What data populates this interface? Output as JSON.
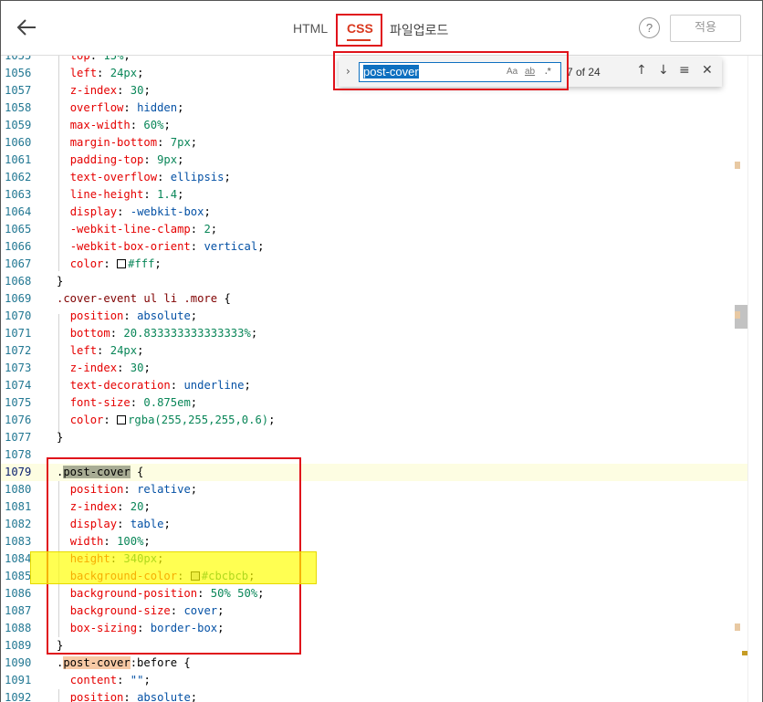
{
  "topbar": {
    "tabs": [
      {
        "label": "HTML"
      },
      {
        "label": "CSS"
      },
      {
        "label": "파일업로드"
      }
    ],
    "help_label": "?",
    "apply_label": "적용"
  },
  "find": {
    "value": "post-cover",
    "match_case": "Aa",
    "whole_word": "ab",
    "regex": ".*",
    "count": "7 of 24"
  },
  "lines": [
    {
      "n": "1055",
      "t": "  top: 15%;"
    },
    {
      "n": "1056",
      "t": "  left: 24px;"
    },
    {
      "n": "1057",
      "t": "  z-index: 30;"
    },
    {
      "n": "1058",
      "t": "  overflow: hidden;"
    },
    {
      "n": "1059",
      "t": "  max-width: 60%;"
    },
    {
      "n": "1060",
      "t": "  margin-bottom: 7px;"
    },
    {
      "n": "1061",
      "t": "  padding-top: 9px;"
    },
    {
      "n": "1062",
      "t": "  text-overflow: ellipsis;"
    },
    {
      "n": "1063",
      "t": "  line-height: 1.4;"
    },
    {
      "n": "1064",
      "t": "  display: -webkit-box;"
    },
    {
      "n": "1065",
      "t": "  -webkit-line-clamp: 2;"
    },
    {
      "n": "1066",
      "t": "  -webkit-box-orient: vertical;"
    },
    {
      "n": "1067",
      "t": "  color: #fff;"
    },
    {
      "n": "1068",
      "t": "}"
    },
    {
      "n": "1069",
      "t": ".cover-event ul li .more {"
    },
    {
      "n": "1070",
      "t": "  position: absolute;"
    },
    {
      "n": "1071",
      "t": "  bottom: 20.833333333333333%;"
    },
    {
      "n": "1072",
      "t": "  left: 24px;"
    },
    {
      "n": "1073",
      "t": "  z-index: 30;"
    },
    {
      "n": "1074",
      "t": "  text-decoration: underline;"
    },
    {
      "n": "1075",
      "t": "  font-size: 0.875em;"
    },
    {
      "n": "1076",
      "t": "  color: rgba(255,255,255,0.6);"
    },
    {
      "n": "1077",
      "t": "}"
    },
    {
      "n": "1078",
      "t": ""
    },
    {
      "n": "1079",
      "t": ".post-cover {"
    },
    {
      "n": "1080",
      "t": "  position: relative;"
    },
    {
      "n": "1081",
      "t": "  z-index: 20;"
    },
    {
      "n": "1082",
      "t": "  display: table;"
    },
    {
      "n": "1083",
      "t": "  width: 100%;"
    },
    {
      "n": "1084",
      "t": "  height: 340px;"
    },
    {
      "n": "1085",
      "t": "  background-color: #cbcbcb;"
    },
    {
      "n": "1086",
      "t": "  background-position: 50% 50%;"
    },
    {
      "n": "1087",
      "t": "  background-size: cover;"
    },
    {
      "n": "1088",
      "t": "  box-sizing: border-box;"
    },
    {
      "n": "1089",
      "t": "}"
    },
    {
      "n": "1090",
      "t": ".post-cover:before {"
    },
    {
      "n": "1091",
      "t": "  content: \"\";"
    },
    {
      "n": "1092",
      "t": "  position: absolute;"
    }
  ],
  "colors": {
    "accent": "#d9381e",
    "annotation_red": "#e0121b",
    "highlight_yellow": "#ffff00",
    "swatch_white": "#fff",
    "swatch_gray": "#cbcbcb"
  },
  "icons": [
    "back-arrow-icon",
    "chevron-right-icon",
    "arrow-up-icon",
    "arrow-down-icon",
    "selection-icon",
    "close-icon"
  ]
}
